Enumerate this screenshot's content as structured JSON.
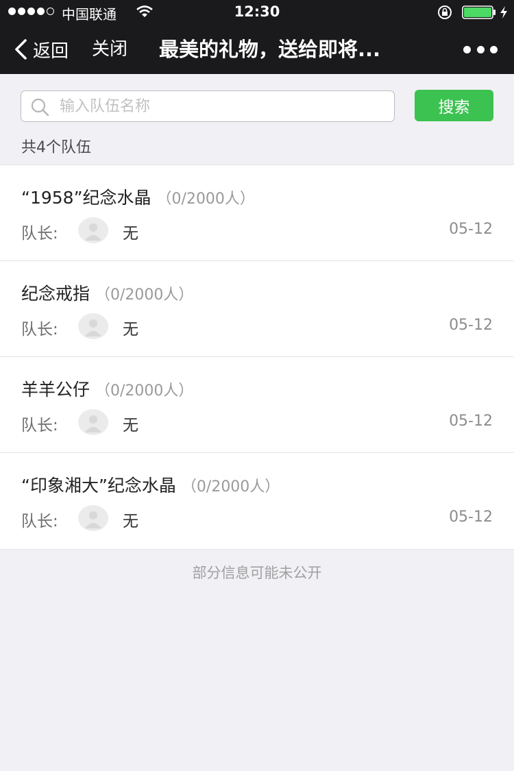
{
  "status_bar": {
    "carrier": "中国联通",
    "time": "12:30",
    "battery_color": "#4cd964"
  },
  "navbar": {
    "back_label": "返回",
    "close_label": "关闭",
    "title": "最美的礼物，送给即将..."
  },
  "search": {
    "placeholder": "输入队伍名称",
    "value": "",
    "button_label": "搜索",
    "button_color": "#3cc250"
  },
  "team_count_text": "共4个队伍",
  "teams": [
    {
      "name": "“1958”纪念水晶",
      "members": "（0/2000人）",
      "leader_label": "队长:",
      "leader": "无",
      "date": "05-12"
    },
    {
      "name": "纪念戒指",
      "members": "（0/2000人）",
      "leader_label": "队长:",
      "leader": "无",
      "date": "05-12"
    },
    {
      "name": "羊羊公仔",
      "members": "（0/2000人）",
      "leader_label": "队长:",
      "leader": "无",
      "date": "05-12"
    },
    {
      "name": "“印象湘大”纪念水晶",
      "members": "（0/2000人）",
      "leader_label": "队长:",
      "leader": "无",
      "date": "05-12"
    }
  ],
  "footer_note": "部分信息可能未公开"
}
